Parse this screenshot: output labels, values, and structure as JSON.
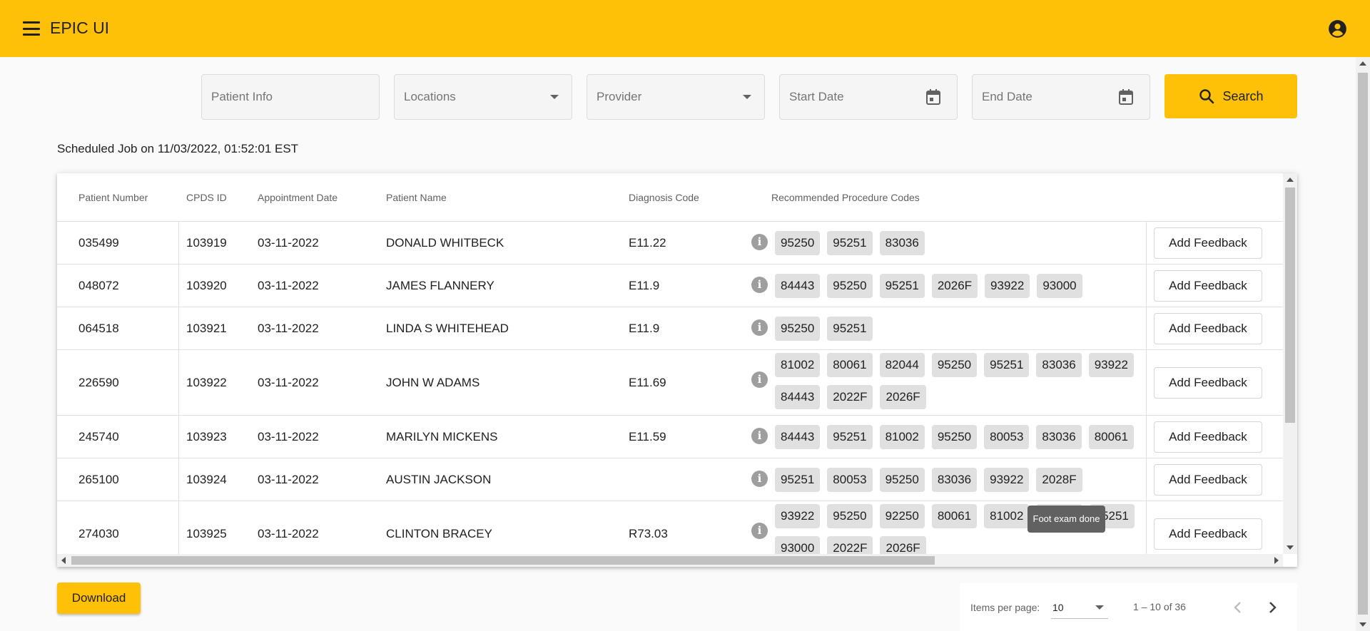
{
  "app": {
    "title": "EPIC UI"
  },
  "colors": {
    "primary": "#ffc107",
    "chip": "#e0e0e0",
    "tooltip": "#616161"
  },
  "filters": {
    "patient_info": "Patient Info",
    "locations": "Locations",
    "provider": "Provider",
    "start_date": "Start Date",
    "end_date": "End Date",
    "search_label": "Search"
  },
  "job_label": "Scheduled Job on 11/03/2022, 01:52:01 EST",
  "table": {
    "headers": [
      "Patient Number",
      "CPDS ID",
      "Appointment Date",
      "Patient Name",
      "Diagnosis Code",
      "Recommended Procedure Codes"
    ],
    "feedback_label": "Add Feedback",
    "rows": [
      {
        "patient_number": "035499",
        "cpds_id": "103919",
        "date": "03-11-2022",
        "name": "DONALD WHITBECK",
        "diagnosis": "E11.22",
        "codes": [
          "95250",
          "95251",
          "83036"
        ]
      },
      {
        "patient_number": "048072",
        "cpds_id": "103920",
        "date": "03-11-2022",
        "name": "JAMES FLANNERY",
        "diagnosis": "E11.9",
        "codes": [
          "84443",
          "95250",
          "95251",
          "2026F",
          "93922",
          "93000"
        ]
      },
      {
        "patient_number": "064518",
        "cpds_id": "103921",
        "date": "03-11-2022",
        "name": "LINDA S WHITEHEAD",
        "diagnosis": "E11.9",
        "codes": [
          "95250",
          "95251"
        ]
      },
      {
        "patient_number": "226590",
        "cpds_id": "103922",
        "date": "03-11-2022",
        "name": "JOHN W ADAMS",
        "diagnosis": "E11.69",
        "codes": [
          "81002",
          "80061",
          "82044",
          "95250",
          "95251",
          "83036",
          "93922",
          "84443",
          "2022F",
          "2026F"
        ]
      },
      {
        "patient_number": "245740",
        "cpds_id": "103923",
        "date": "03-11-2022",
        "name": "MARILYN MICKENS",
        "diagnosis": "E11.59",
        "codes": [
          "84443",
          "95251",
          "81002",
          "95250",
          "80053",
          "83036",
          "80061"
        ]
      },
      {
        "patient_number": "265100",
        "cpds_id": "103924",
        "date": "03-11-2022",
        "name": "AUSTIN JACKSON",
        "diagnosis": "",
        "codes": [
          "95251",
          "80053",
          "95250",
          "83036",
          "93922",
          "2028F"
        ]
      },
      {
        "patient_number": "274030",
        "cpds_id": "103925",
        "date": "03-11-2022",
        "name": "CLINTON BRACEY",
        "diagnosis": "R73.03",
        "codes": [
          "93922",
          "95250",
          "92250",
          "80061",
          "81002",
          "2028F",
          "95251",
          "93000",
          "2022F",
          "2026F"
        ]
      }
    ]
  },
  "tooltip": "Foot exam done",
  "download_label": "Download",
  "paginator": {
    "label": "Items per page:",
    "page_size": "10",
    "range": "1 – 10 of 36"
  }
}
